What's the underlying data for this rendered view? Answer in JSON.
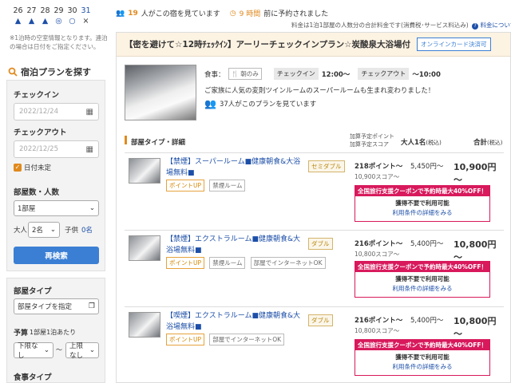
{
  "calendar": {
    "days": [
      "26",
      "27",
      "28",
      "29",
      "30",
      "31"
    ],
    "marks": [
      "▲",
      "▲",
      "▲",
      "◎",
      "○",
      "×"
    ],
    "note": "※1泊時の空室情報となります。連泊の場合は日付をご指定ください。"
  },
  "search": {
    "title": "宿泊プランを探す",
    "checkin_label": "チェックイン",
    "checkin_value": "2022/12/24",
    "checkout_label": "チェックアウト",
    "checkout_value": "2022/12/25",
    "undecided_label": "日付未定",
    "rooms_label": "部屋数・人数",
    "rooms_value": "1部屋",
    "adults_label": "大人",
    "adults_value": "2名",
    "children_label": "子供",
    "children_value": "0名",
    "search_button": "再検索"
  },
  "filters": {
    "room_type_label": "部屋タイプ",
    "room_type_value": "部屋タイプを指定",
    "budget_label": "予算",
    "budget_sub": "1部屋1泊あたり",
    "min_value": "下限なし",
    "max_value": "上限なし",
    "meal_label": "食事タイプ"
  },
  "top": {
    "viewers_count": "19",
    "viewers_text": "人がこの宿を見ています",
    "booked_time": "9 時間",
    "booked_text": "前に予約されました",
    "price_note": "料金は1泊1部屋の人数分の合計料金です(消費税･サービス料込み)",
    "price_link": "料金について"
  },
  "plan": {
    "title": "【密を避けて☆12時ﾁｪｯｸｲﾝ】アーリーチェックインプラン☆炭酸泉大浴場付",
    "online_badge": "オンラインカード決済可",
    "meal_label": "食事：",
    "meal_value": "朝のみ",
    "checkin_label": "チェックイン",
    "checkin_value": "12:00～",
    "checkout_label": "チェックアウト",
    "checkout_value": "～10:00",
    "description": "ご家族に人気の変則ツインルームのスーパールームも生まれ変わりました！",
    "viewers": "37人がこのプランを見ています"
  },
  "columns": {
    "room": "部屋タイプ・詳細",
    "points_l1": "加算予定ポイント",
    "points_l2": "加算予定スコア",
    "adult1": "大人1名",
    "adult1_tax": "(税込)",
    "total": "合計",
    "total_tax": "(税込)"
  },
  "rooms": [
    {
      "name": "【禁煙】スーパールーム■健康朝食&大浴場無料■",
      "type": "セミダブル",
      "tags": [
        "ポイントUP",
        "禁煙ルーム"
      ],
      "points": "218ポイント～",
      "score": "10,900スコア～",
      "price": "5,450円～",
      "total": "10,900円～",
      "coupon": "全国旅行支援クーポンで予約時最大40%OFF！",
      "coupon1": "獲得不要で利用可能",
      "coupon2": "利用条件の詳細をみる"
    },
    {
      "name": "【禁煙】エクストラルーム■健康朝食&大浴場無料■",
      "type": "ダブル",
      "tags": [
        "ポイントUP",
        "禁煙ルーム",
        "部屋でインターネットOK"
      ],
      "points": "216ポイント～",
      "score": "10,800スコア～",
      "price": "5,400円～",
      "total": "10,800円～",
      "coupon": "全国旅行支援クーポンで予約時最大40%OFF！",
      "coupon1": "獲得不要で利用可能",
      "coupon2": "利用条件の詳細をみる"
    },
    {
      "name": "【喫煙】エクストラルーム■健康朝食&大浴場無料■",
      "type": "ダブル",
      "tags": [
        "ポイントUP",
        "部屋でインターネットOK"
      ],
      "points": "216ポイント～",
      "score": "10,800スコア～",
      "price": "5,400円～",
      "total": "10,800円～",
      "coupon": "全国旅行支援クーポンで予約時最大40%OFF！",
      "coupon1": "獲得不要で利用可能",
      "coupon2": "利用条件の詳細をみる"
    }
  ]
}
